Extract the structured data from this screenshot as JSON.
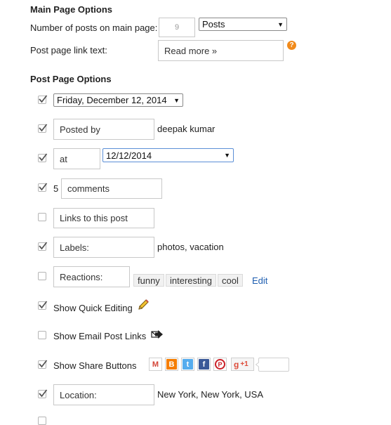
{
  "main_page": {
    "heading": "Main Page Options",
    "num_posts_label": "Number of posts on main page:",
    "num_posts_value": "9",
    "num_posts_unit": "Posts",
    "link_text_label": "Post page link text:",
    "link_text_value": "Read more »"
  },
  "post_page": {
    "heading": "Post Page Options",
    "date_format": "Friday, December 12, 2014",
    "posted_by_label": "Posted by",
    "posted_by_value": "deepak kumar",
    "at_label": "at",
    "time_format": "12/12/2014",
    "comments_count": "5",
    "comments_label": "comments",
    "backlinks_label": "Links to this post",
    "labels_label": "Labels:",
    "labels_value": "photos, vacation",
    "reactions_label": "Reactions:",
    "reactions": [
      "funny",
      "interesting",
      "cool"
    ],
    "reactions_edit": "Edit",
    "quick_edit_label": "Show Quick Editing",
    "email_links_label": "Show Email Post Links",
    "share_buttons_label": "Show Share Buttons",
    "plusone_label": "+1",
    "location_label": "Location:",
    "location_value": "New York, New York, USA"
  },
  "checkboxes": {
    "date": true,
    "posted_by": true,
    "time": true,
    "comments": true,
    "backlinks": false,
    "labels": true,
    "reactions": false,
    "quick_edit": true,
    "email_links": false,
    "share_buttons": true,
    "location": true
  },
  "icons": {
    "help": "help-question-icon",
    "pencil": "pencil-icon",
    "email": "email-post-icon",
    "gmail": "gmail-share-icon",
    "blogger": "blogger-share-icon",
    "twitter": "twitter-share-icon",
    "facebook": "facebook-share-icon",
    "pinterest": "pinterest-share-icon",
    "google_plus": "google-plus-share-icon"
  },
  "colors": {
    "link": "#1e5eb0",
    "help": "#f18a1a",
    "blogger": "#f57d00",
    "twitter": "#55acee",
    "facebook": "#3b5998",
    "pinterest": "#cb2027",
    "google_plus": "#dd4b39",
    "gmail": "#d44638"
  }
}
